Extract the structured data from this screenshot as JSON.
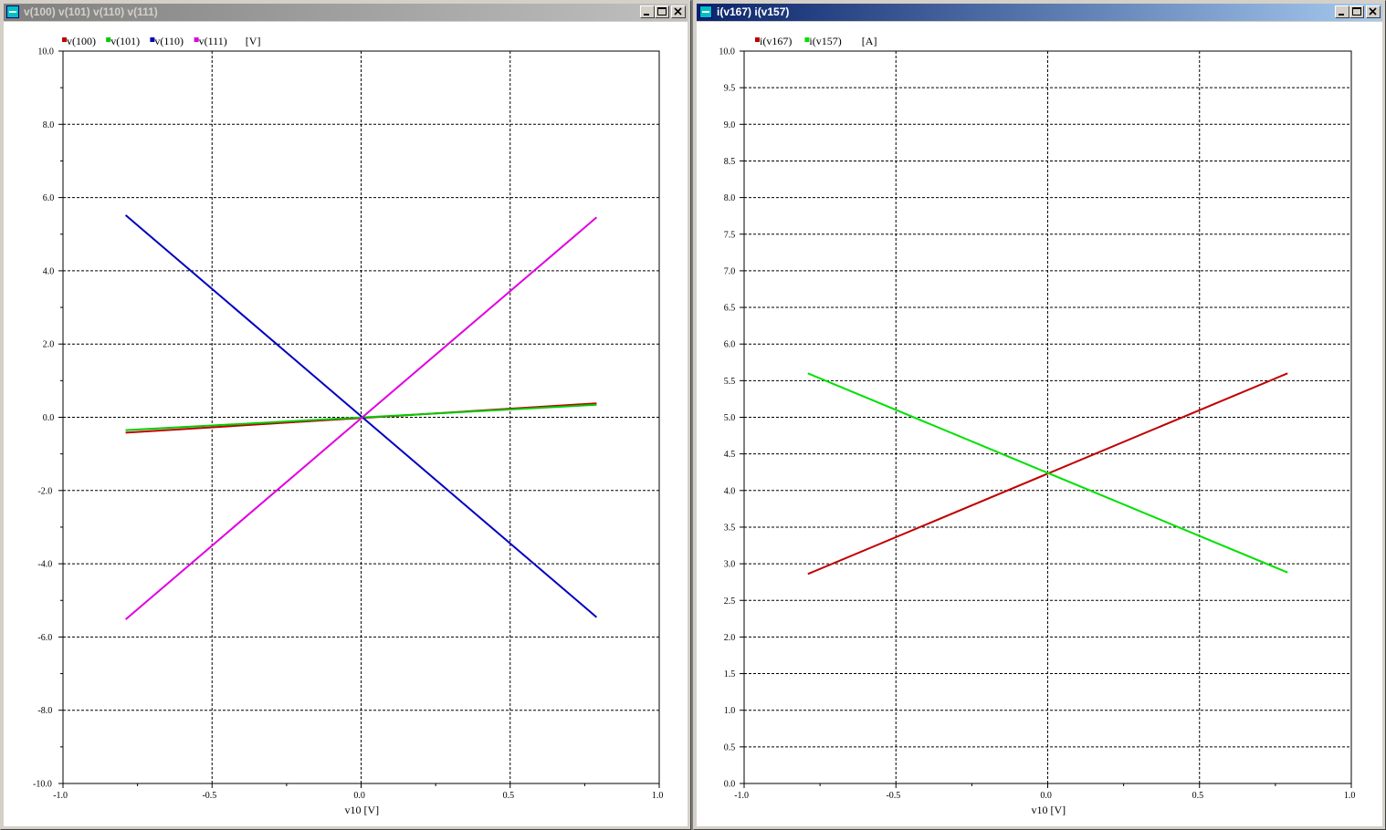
{
  "windows": [
    {
      "title": "v(100) v(101) v(110) v(111)",
      "active": false,
      "chart_data": {
        "type": "line",
        "x_label": "v10 [V]",
        "unit_label": "[V]",
        "xlim": [
          -1.0,
          1.0
        ],
        "ylim": [
          -10.0,
          10.0
        ],
        "x_ticks": [
          "-1.0",
          "-0.5",
          "0.0",
          "0.5",
          "1.0"
        ],
        "y_ticks": [
          "-10.0",
          "-8.0",
          "-6.0",
          "-4.0",
          "-2.0",
          "0.0",
          "2.0",
          "4.0",
          "6.0",
          "8.0",
          "10.0"
        ],
        "grid": true,
        "legend_position": "top-left",
        "series": [
          {
            "name": "v(100)",
            "color": "#c00000",
            "x": [
              -0.79,
              0.79
            ],
            "y": [
              -0.42,
              0.38
            ]
          },
          {
            "name": "v(101)",
            "color": "#00cc00",
            "x": [
              -0.79,
              0.79
            ],
            "y": [
              -0.35,
              0.34
            ]
          },
          {
            "name": "v(110)",
            "color": "#0000c0",
            "x": [
              -0.79,
              0.79
            ],
            "y": [
              5.52,
              -5.46
            ]
          },
          {
            "name": "v(111)",
            "color": "#e000e0",
            "x": [
              -0.79,
              0.79
            ],
            "y": [
              -5.52,
              5.46
            ]
          }
        ]
      }
    },
    {
      "title": "i(v167) i(v157)",
      "active": true,
      "chart_data": {
        "type": "line",
        "x_label": "v10 [V]",
        "unit_label": "[A]",
        "xlim": [
          -1.0,
          1.0
        ],
        "ylim": [
          0.0,
          10.0
        ],
        "x_ticks": [
          "-1.0",
          "-0.5",
          "0.0",
          "0.5",
          "1.0"
        ],
        "y_ticks": [
          "0.0",
          "0.5",
          "1.0",
          "1.5",
          "2.0",
          "2.5",
          "3.0",
          "3.5",
          "4.0",
          "4.5",
          "5.0",
          "5.5",
          "6.0",
          "6.5",
          "7.0",
          "7.5",
          "8.0",
          "8.5",
          "9.0",
          "9.5",
          "10.0"
        ],
        "grid": true,
        "legend_position": "top-left",
        "series": [
          {
            "name": "i(v167)",
            "color": "#c00000",
            "x": [
              -0.79,
              0.79
            ],
            "y": [
              2.86,
              5.6
            ]
          },
          {
            "name": "i(v157)",
            "color": "#00e000",
            "x": [
              -0.79,
              0.79
            ],
            "y": [
              5.6,
              2.88
            ]
          }
        ]
      }
    }
  ]
}
